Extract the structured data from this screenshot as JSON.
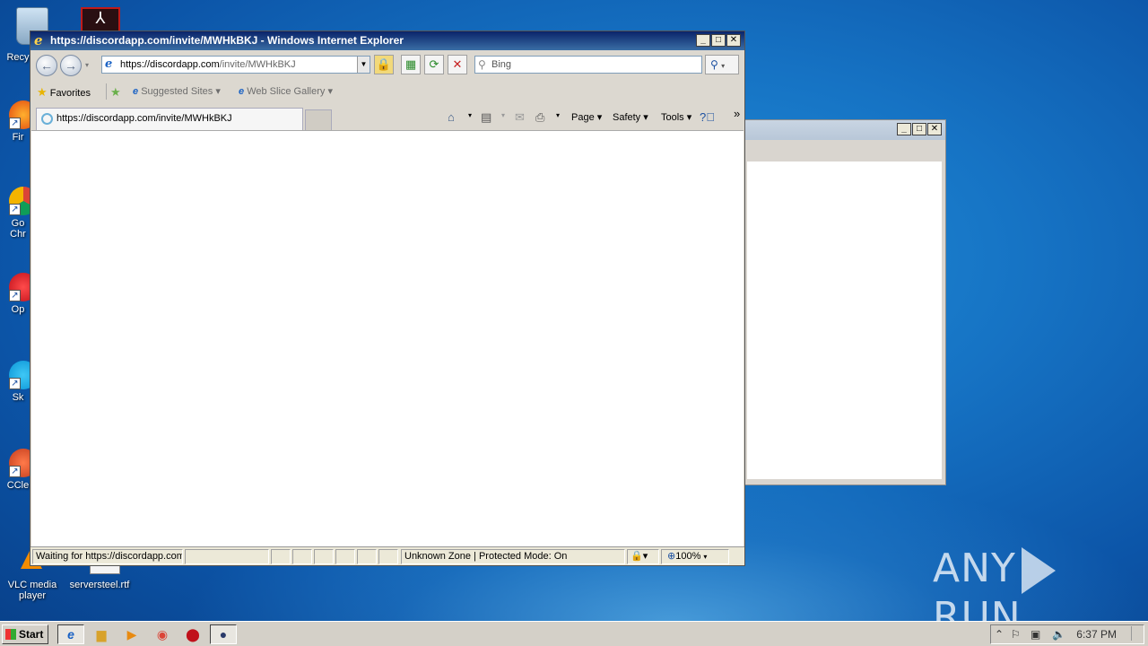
{
  "window": {
    "title": "https://discordapp.com/invite/MWHkBKJ - Windows Internet Explorer",
    "minimize": "_",
    "maximize": "□",
    "close": "✕"
  },
  "navbar": {
    "back_icon": "back-arrow-icon",
    "forward_icon": "forward-arrow-icon",
    "address_host": "https://discordapp.com",
    "address_path": "/invite/MWHkBKJ",
    "search_placeholder": "Bing"
  },
  "favorites": {
    "favorites_label": "Favorites",
    "suggested_label": "Suggested Sites ▾",
    "webslice_label": "Web Slice Gallery ▾"
  },
  "tab": {
    "label": "https://discordapp.com/invite/MWHkBKJ"
  },
  "commandbar": {
    "page": "Page ▾",
    "safety": "Safety ▾",
    "tools": "Tools ▾",
    "more": "»"
  },
  "status": {
    "text": "Waiting for https://discordapp.com",
    "zone": "Unknown Zone | Protected Mode: On",
    "zoom": "100%"
  },
  "desktop": {
    "icons": [
      {
        "label": "Recy"
      },
      {
        "label": "Fir"
      },
      {
        "label": "Go"
      },
      {
        "label": "Chr"
      },
      {
        "label": "Op"
      },
      {
        "label": "Sk"
      },
      {
        "label": "CCle"
      },
      {
        "label": "VLC media player"
      },
      {
        "label": "serversteel.rtf"
      }
    ]
  },
  "taskbar": {
    "start": "Start",
    "clock": "6:37 PM",
    "tray_up": "⌃"
  },
  "watermark": {
    "left": "ANY",
    "right": "RUN"
  }
}
